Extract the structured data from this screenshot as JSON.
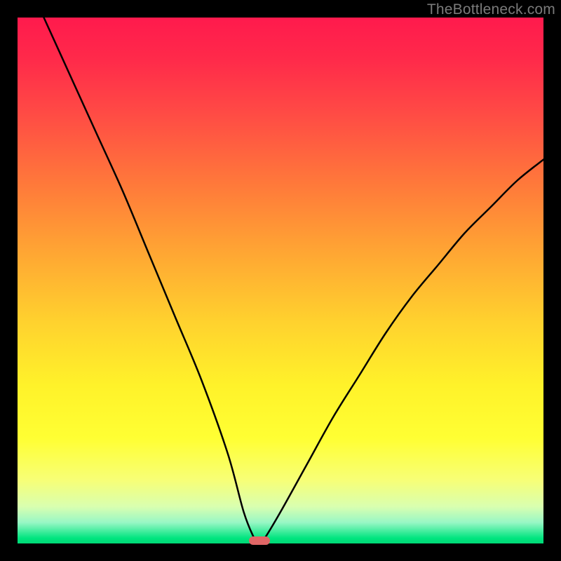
{
  "watermark": "TheBottleneck.com",
  "chart_data": {
    "type": "line",
    "title": "",
    "xlabel": "",
    "ylabel": "",
    "xlim": [
      0,
      100
    ],
    "ylim": [
      0,
      100
    ],
    "grid": false,
    "legend": false,
    "series": [
      {
        "name": "bottleneck-curve",
        "x": [
          5,
          10,
          15,
          20,
          25,
          30,
          35,
          40,
          43,
          45,
          46,
          47,
          50,
          55,
          60,
          65,
          70,
          75,
          80,
          85,
          90,
          95,
          100
        ],
        "y": [
          100,
          89,
          78,
          67,
          55,
          43,
          31,
          17,
          6,
          1,
          0,
          1,
          6,
          15,
          24,
          32,
          40,
          47,
          53,
          59,
          64,
          69,
          73
        ]
      }
    ],
    "marker": {
      "x": 46,
      "y": 0.5,
      "color": "#e06666"
    },
    "background_gradient": {
      "orientation": "vertical",
      "stops": [
        {
          "pos": 0.0,
          "color": "#ff1a4d"
        },
        {
          "pos": 0.5,
          "color": "#ffc030"
        },
        {
          "pos": 0.8,
          "color": "#ffff33"
        },
        {
          "pos": 0.97,
          "color": "#7df0b0"
        },
        {
          "pos": 1.0,
          "color": "#00d976"
        }
      ]
    }
  }
}
